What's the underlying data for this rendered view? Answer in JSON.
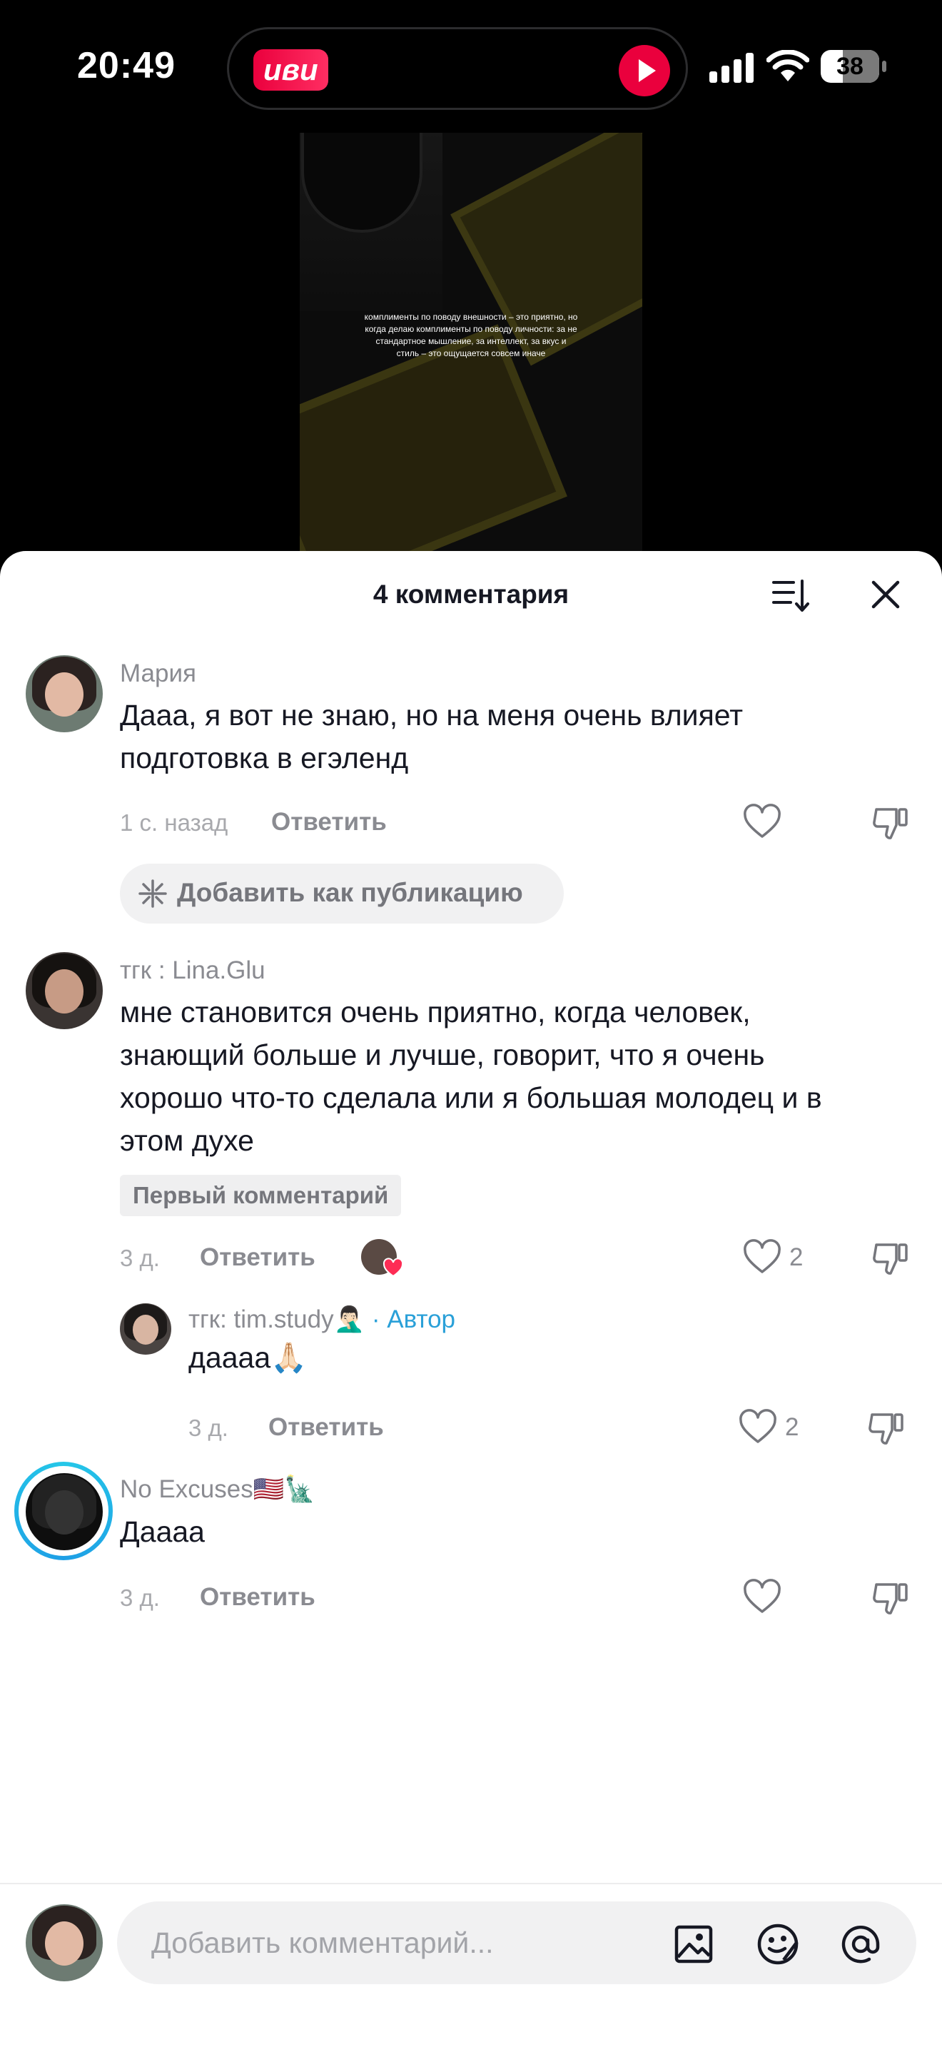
{
  "status_bar": {
    "time": "20:49",
    "island_app": "иви",
    "battery": "38",
    "battery_percent": 38
  },
  "video": {
    "caption": "комплименты по поводу внешности – это приятно, но когда делаю комплименты по поводу личности: за не стандартное мышление, за интеллект, за вкус и стиль – это ощущается совсем иначе"
  },
  "sheet": {
    "title": "4 комментария",
    "sort_icon": "sort-icon",
    "close_icon": "close-icon"
  },
  "comments": [
    {
      "author": "Мария",
      "text_lines": [
        "Дааа, я вот не знаю, но на меня очень влияет",
        "подготовка в егэленд"
      ],
      "time": "1 с. назад",
      "reply_label": "Ответить",
      "likes": "",
      "add_post_label": "Добавить как публикацию"
    },
    {
      "author": "тгк : Lina.Glu",
      "text_lines": [
        "мне становится очень приятно, когда человек,",
        "знающий больше и лучше, говорит, что я очень",
        "хорошо что-то сделала или я большая молодец и в",
        "этом духе"
      ],
      "tag": "Первый комментарий",
      "time": "3 д.",
      "reply_label": "Ответить",
      "likes": "2"
    },
    {
      "author": "тгк: tim.study🤦🏻‍♂️",
      "author_badge": "· Автор",
      "text": "даааа🙏🏻",
      "time": "3 д.",
      "reply_label": "Ответить",
      "likes": "2"
    },
    {
      "author": "No Excuses🇺🇸🗽",
      "text": "Даааа",
      "time": "3 д.",
      "reply_label": "Ответить",
      "likes": ""
    }
  ],
  "input": {
    "placeholder": "Добавить комментарий..."
  },
  "icons": {
    "image": "image-icon",
    "emoji": "emoji-icon",
    "mention": "at-icon",
    "like": "heart-icon",
    "dislike": "dislike-icon"
  },
  "colors": {
    "accent": "#2aa0d8",
    "ivi_red": "#ea003d",
    "story_ring": "#25c7e8",
    "like_red": "#fe2c55"
  }
}
